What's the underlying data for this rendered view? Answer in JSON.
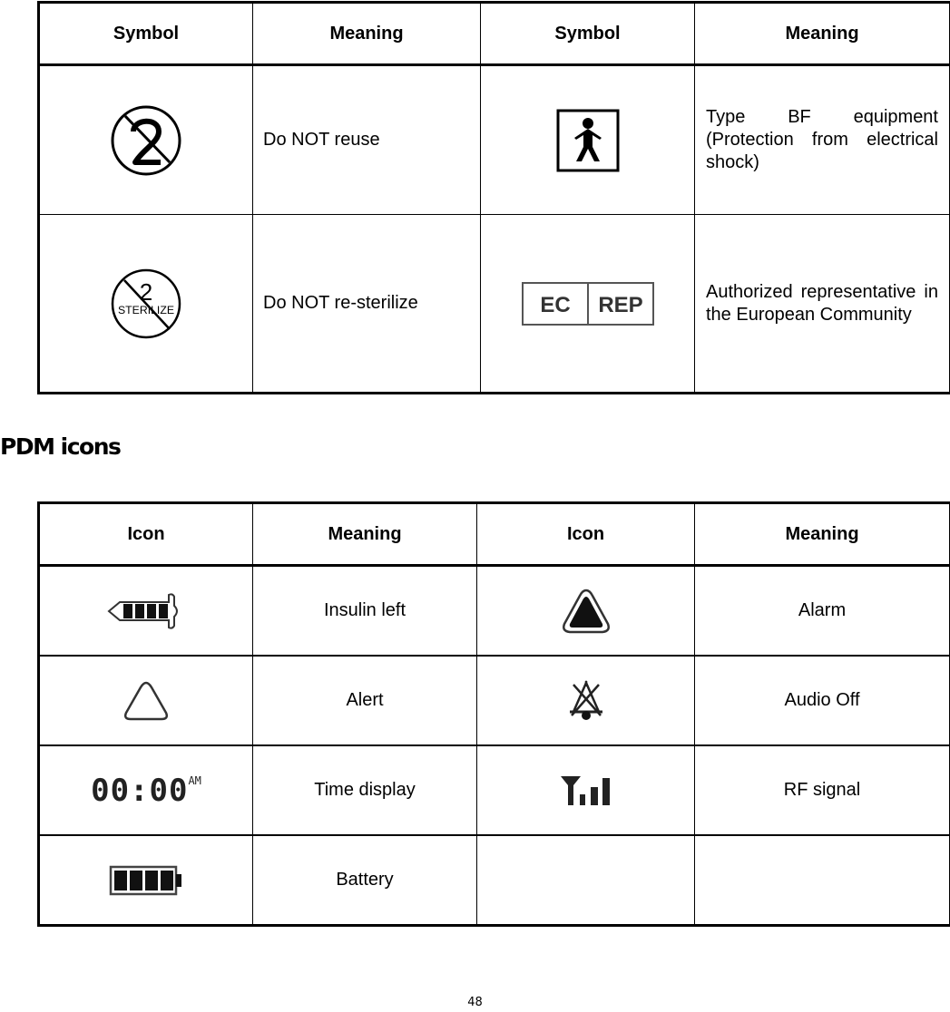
{
  "symbols_table": {
    "headers": [
      "Symbol",
      "Meaning",
      "Symbol",
      "Meaning"
    ],
    "rows": [
      {
        "left_icon": "do-not-reuse-icon",
        "left_meaning": "Do NOT reuse",
        "right_icon": "type-bf-equipment-icon",
        "right_meaning": "Type BF equipment (Protection from electrical shock)"
      },
      {
        "left_icon": "do-not-resterilize-icon",
        "left_icon_text": {
          "number": "2",
          "word": "STERILIZE"
        },
        "left_meaning": "Do NOT re-sterilize",
        "right_icon": "ec-rep-icon",
        "right_icon_text": {
          "left": "EC",
          "right": "REP"
        },
        "right_meaning": "Authorized representative in the European Community"
      }
    ]
  },
  "section_title": "PDM icons",
  "pdm_table": {
    "headers": [
      "Icon",
      "Meaning",
      "Icon",
      "Meaning"
    ],
    "rows": [
      {
        "left_icon": "insulin-cartridge-icon",
        "left_meaning": "Insulin left",
        "right_icon": "alarm-icon",
        "right_meaning": "Alarm"
      },
      {
        "left_icon": "alert-icon",
        "left_meaning": "Alert",
        "right_icon": "audio-off-icon",
        "right_meaning": "Audio Off"
      },
      {
        "left_icon": "time-display-icon",
        "left_icon_text": {
          "time": "00:00",
          "suffix": "AM"
        },
        "left_meaning": "Time display",
        "right_icon": "rf-signal-icon",
        "right_meaning": "RF signal"
      },
      {
        "left_icon": "battery-icon",
        "left_meaning": "Battery",
        "right_icon": "",
        "right_meaning": ""
      }
    ]
  },
  "page_number": "48"
}
